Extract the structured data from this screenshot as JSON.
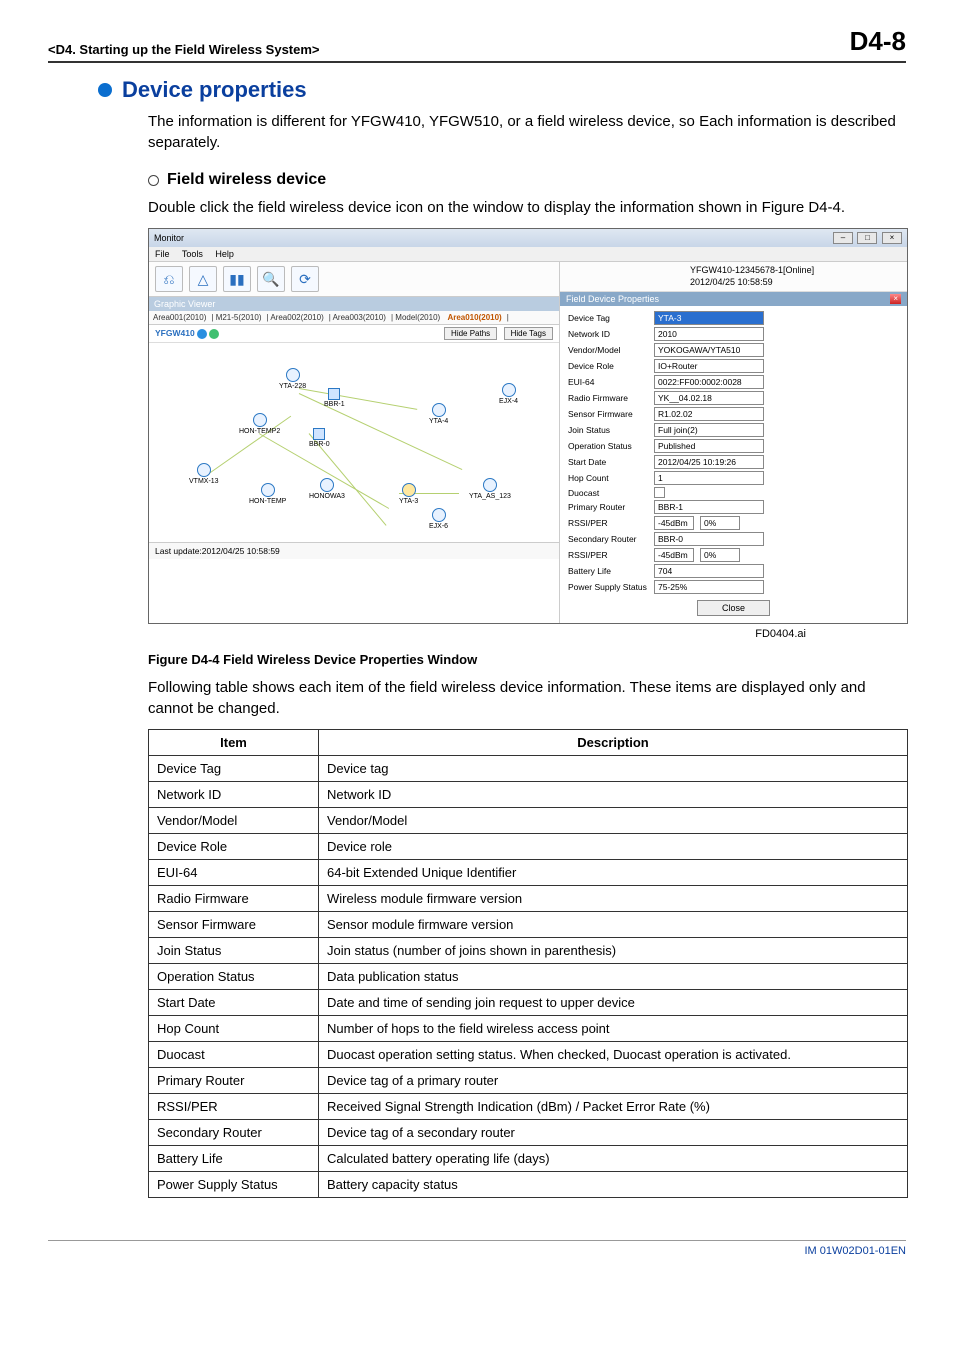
{
  "header": {
    "chapter": "<D4.  Starting up the Field Wireless System>",
    "page": "D4-8"
  },
  "section": {
    "title": "Device properties",
    "intro": "The information is different for YFGW410, YFGW510, or a field wireless device, so Each information is described separately."
  },
  "subsection": {
    "title": "Field wireless device",
    "intro": "Double click the field wireless device icon on the window to display the information shown in Figure D4-4."
  },
  "screenshot": {
    "window_title": "Monitor",
    "menus": [
      "File",
      "Tools",
      "Help"
    ],
    "status_right": {
      "line1": "YFGW410-12345678-1[Online]",
      "line2": "2012/04/25 10:58:59"
    },
    "graphic_viewer_label": "Graphic Viewer",
    "tabs": [
      "Area001(2010)",
      "M21-5(2010)",
      "Area002(2010)",
      "Area003(2010)",
      "Model(2010)",
      "Area010(2010)"
    ],
    "yfgw_label": "YFGW410",
    "hide_paths": "Hide Paths",
    "hide_tags": "Hide Tags",
    "nodes": [
      "YTA-228",
      "BBR-1",
      "EJX-4",
      "HON-TEMP2",
      "YTA-4",
      "BBR-0",
      "VTMX-13",
      "HON-TEMP",
      "HONOWA3",
      "YTA-3",
      "YTA_AS_123",
      "EJX-6"
    ],
    "last_update": "Last update:2012/04/25 10:58:59",
    "prop_title": "Field Device Properties",
    "props": {
      "device_tag": {
        "lbl": "Device Tag",
        "val": "YTA-3"
      },
      "network_id": {
        "lbl": "Network ID",
        "val": "2010"
      },
      "vendor_model": {
        "lbl": "Vendor/Model",
        "val": "YOKOGAWA/YTA510"
      },
      "device_role": {
        "lbl": "Device Role",
        "val": "IO+Router"
      },
      "eui64": {
        "lbl": "EUI-64",
        "val": "0022:FF00:0002:0028"
      },
      "radio_fw": {
        "lbl": "Radio Firmware",
        "val": "YK__04.02.18"
      },
      "sensor_fw": {
        "lbl": "Sensor Firmware",
        "val": "R1.02.02"
      },
      "join_status": {
        "lbl": "Join Status",
        "val": "Full join(2)"
      },
      "op_status": {
        "lbl": "Operation Status",
        "val": "Published"
      },
      "start_date": {
        "lbl": "Start Date",
        "val": "2012/04/25 10:19:26"
      },
      "hop_count": {
        "lbl": "Hop Count",
        "val": "1"
      },
      "duocast": {
        "lbl": "Duocast"
      },
      "primary_router": {
        "lbl": "Primary Router",
        "val": "BBR-1"
      },
      "rssi_per_lbl": "RSSI/PER",
      "rssi1": "-45dBm",
      "per1": "0%",
      "secondary_router": {
        "lbl": "Secondary Router",
        "val": "BBR-0"
      },
      "rssi2": "-45dBm",
      "per2": "0%",
      "battery_life": {
        "lbl": "Battery Life",
        "val": "704"
      },
      "power_supply": {
        "lbl": "Power Supply Status",
        "val": "75-25%"
      },
      "close": "Close"
    }
  },
  "figure": {
    "id": "FD0404.ai",
    "caption": "Figure D4-4  Field Wireless Device Properties Window"
  },
  "table_intro": "Following table shows each item of the field wireless device information. These items are displayed only and cannot be changed.",
  "table": {
    "headers": [
      "Item",
      "Description"
    ],
    "rows": [
      [
        "Device Tag",
        "Device tag"
      ],
      [
        "Network ID",
        "Network ID"
      ],
      [
        "Vendor/Model",
        "Vendor/Model"
      ],
      [
        "Device Role",
        "Device role"
      ],
      [
        "EUI-64",
        "64-bit Extended Unique Identifier"
      ],
      [
        "Radio Firmware",
        "Wireless module firmware version"
      ],
      [
        "Sensor Firmware",
        "Sensor module firmware version"
      ],
      [
        "Join Status",
        "Join status (number of joins shown in parenthesis)"
      ],
      [
        "Operation Status",
        "Data publication status"
      ],
      [
        "Start Date",
        "Date and time of sending join request to upper device"
      ],
      [
        "Hop Count",
        "Number of hops to the field wireless access point"
      ],
      [
        "Duocast",
        "Duocast operation setting status. When checked, Duocast operation is activated."
      ],
      [
        "Primary Router",
        "Device tag of a primary router"
      ],
      [
        "RSSI/PER",
        "Received Signal Strength Indication (dBm) / Packet Error Rate (%)"
      ],
      [
        "Secondary Router",
        "Device tag of a secondary router"
      ],
      [
        "Battery Life",
        "Calculated battery operating life (days)"
      ],
      [
        "Power Supply Status",
        "Battery capacity status"
      ]
    ]
  },
  "footer": "IM 01W02D01-01EN"
}
